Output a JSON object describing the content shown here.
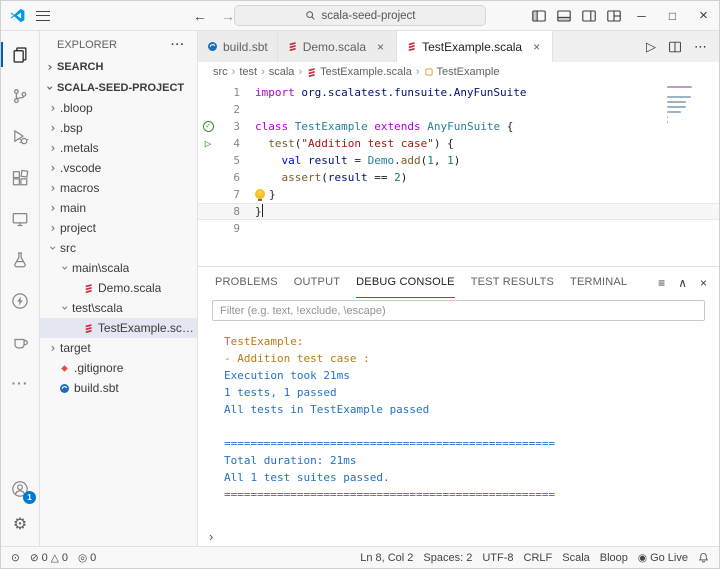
{
  "colors": {
    "accent": "#005fb8",
    "badge": "#007acc",
    "panel_accent": "#b5392c",
    "console_orange": "#bd7a16",
    "console_blue": "#2472c8"
  },
  "titlebar": {
    "search_value": "scala-seed-project",
    "window_controls": {
      "minimize": "─",
      "maximize": "□",
      "close": "×"
    }
  },
  "activity_bar": {
    "items": [
      {
        "name": "explorer",
        "active": true
      },
      {
        "name": "source-control"
      },
      {
        "name": "run-and-debug"
      },
      {
        "name": "extensions"
      },
      {
        "name": "remote-explorer"
      },
      {
        "name": "testing"
      },
      {
        "name": "metals"
      },
      {
        "name": "java"
      },
      {
        "name": "more"
      }
    ],
    "account_badge": "1"
  },
  "explorer": {
    "title": "EXPLORER",
    "search_section": "SEARCH",
    "project_section": "SCALA-SEED-PROJECT",
    "tree": [
      {
        "label": ".bloop",
        "type": "folder",
        "depth": 0
      },
      {
        "label": ".bsp",
        "type": "folder",
        "depth": 0
      },
      {
        "label": ".metals",
        "type": "folder",
        "depth": 0
      },
      {
        "label": ".vscode",
        "type": "folder",
        "depth": 0
      },
      {
        "label": "macros",
        "type": "folder",
        "depth": 0
      },
      {
        "label": "main",
        "type": "folder",
        "depth": 0
      },
      {
        "label": "project",
        "type": "folder",
        "depth": 0
      },
      {
        "label": "src",
        "type": "folder",
        "depth": 0,
        "expanded": true
      },
      {
        "label": "main\\scala",
        "type": "folder",
        "depth": 1,
        "expanded": true
      },
      {
        "label": "Demo.scala",
        "type": "scala-file",
        "depth": 2
      },
      {
        "label": "test\\scala",
        "type": "folder",
        "depth": 1,
        "expanded": true
      },
      {
        "label": "TestExample.scala",
        "type": "scala-file",
        "depth": 2,
        "selected": true
      },
      {
        "label": "target",
        "type": "folder",
        "depth": 0
      },
      {
        "label": ".gitignore",
        "type": "git-file",
        "depth": 0
      },
      {
        "label": "build.sbt",
        "type": "sbt-file",
        "depth": 0
      }
    ]
  },
  "editor": {
    "tabs": [
      {
        "label": "build.sbt",
        "icon": "sbt",
        "closable": false
      },
      {
        "label": "Demo.scala",
        "icon": "scala",
        "closable": true
      },
      {
        "label": "TestExample.scala",
        "icon": "scala",
        "closable": true,
        "active": true
      }
    ],
    "breadcrumbs": [
      {
        "label": "src"
      },
      {
        "label": "test"
      },
      {
        "label": "scala"
      },
      {
        "label": "TestExample.scala",
        "icon": "scala"
      },
      {
        "label": "TestExample",
        "icon": "symbol-class"
      }
    ],
    "lines": [
      {
        "n": "1",
        "tokens": [
          [
            "import",
            "kw"
          ],
          [
            " org.scalatest.funsuite.AnyFunSuite",
            "ns"
          ]
        ]
      },
      {
        "n": "2",
        "tokens": []
      },
      {
        "n": "3",
        "deco": "pass",
        "tokens": [
          [
            "class ",
            "kw"
          ],
          [
            "TestExample ",
            "type"
          ],
          [
            "extends ",
            "kw"
          ],
          [
            "AnyFunSuite",
            "type"
          ],
          [
            " {",
            "pl"
          ]
        ]
      },
      {
        "n": "4",
        "deco": "run",
        "tokens": [
          [
            "  ",
            "pl"
          ],
          [
            "test",
            "fn"
          ],
          [
            "(",
            "pl"
          ],
          [
            "\"Addition test case\"",
            "str"
          ],
          [
            ") {",
            "pl"
          ]
        ]
      },
      {
        "n": "5",
        "tokens": [
          [
            "    ",
            "pl"
          ],
          [
            "val ",
            "kwb"
          ],
          [
            "result",
            "var"
          ],
          [
            " = ",
            "pl"
          ],
          [
            "Demo",
            "type"
          ],
          [
            ".",
            "pl"
          ],
          [
            "add",
            "fn"
          ],
          [
            "(",
            "pl"
          ],
          [
            "1",
            "num"
          ],
          [
            ", ",
            "pl"
          ],
          [
            "1",
            "num"
          ],
          [
            ")",
            "pl"
          ]
        ]
      },
      {
        "n": "6",
        "tokens": [
          [
            "    ",
            "pl"
          ],
          [
            "assert",
            "fn"
          ],
          [
            "(",
            "pl"
          ],
          [
            "result",
            "var"
          ],
          [
            " == ",
            "pl"
          ],
          [
            "2",
            "num"
          ],
          [
            ")",
            "pl"
          ]
        ]
      },
      {
        "n": "7",
        "lightbulb": true,
        "tokens": [
          [
            "}",
            "pl"
          ]
        ]
      },
      {
        "n": "8",
        "current": true,
        "cursor": true,
        "tokens": [
          [
            "}",
            "pl"
          ]
        ]
      },
      {
        "n": "9",
        "tokens": []
      }
    ]
  },
  "panel": {
    "tabs": [
      {
        "label": "PROBLEMS"
      },
      {
        "label": "OUTPUT"
      },
      {
        "label": "DEBUG CONSOLE",
        "active": true
      },
      {
        "label": "TEST RESULTS"
      },
      {
        "label": "TERMINAL"
      }
    ],
    "filter_placeholder": "Filter (e.g. text, !exclude, \\escape)",
    "console": [
      {
        "text": "TestExample:",
        "color": "orange"
      },
      {
        "text": "- Addition test case :",
        "color": "orange"
      },
      {
        "text": "Execution took 21ms",
        "color": "blue"
      },
      {
        "text": "1 tests, 1 passed",
        "color": "blue"
      },
      {
        "text": "All tests in TestExample passed",
        "color": "blue"
      },
      {
        "text": "",
        "color": "blue"
      },
      {
        "text": "==================================================",
        "color": "blue"
      },
      {
        "text": "Total duration: 21ms",
        "color": "blue"
      },
      {
        "text": "All 1 test suites passed.",
        "color": "blue"
      },
      {
        "text": "==================================================",
        "color": "blue"
      }
    ]
  },
  "statusbar": {
    "errors": "0",
    "warnings": "0",
    "broadcast": "0",
    "cursor_position": "Ln 8, Col 2",
    "indentation": "Spaces: 2",
    "encoding": "UTF-8",
    "eol": "CRLF",
    "language": "Scala",
    "build_server": "Bloop",
    "go_live": "Go Live"
  }
}
